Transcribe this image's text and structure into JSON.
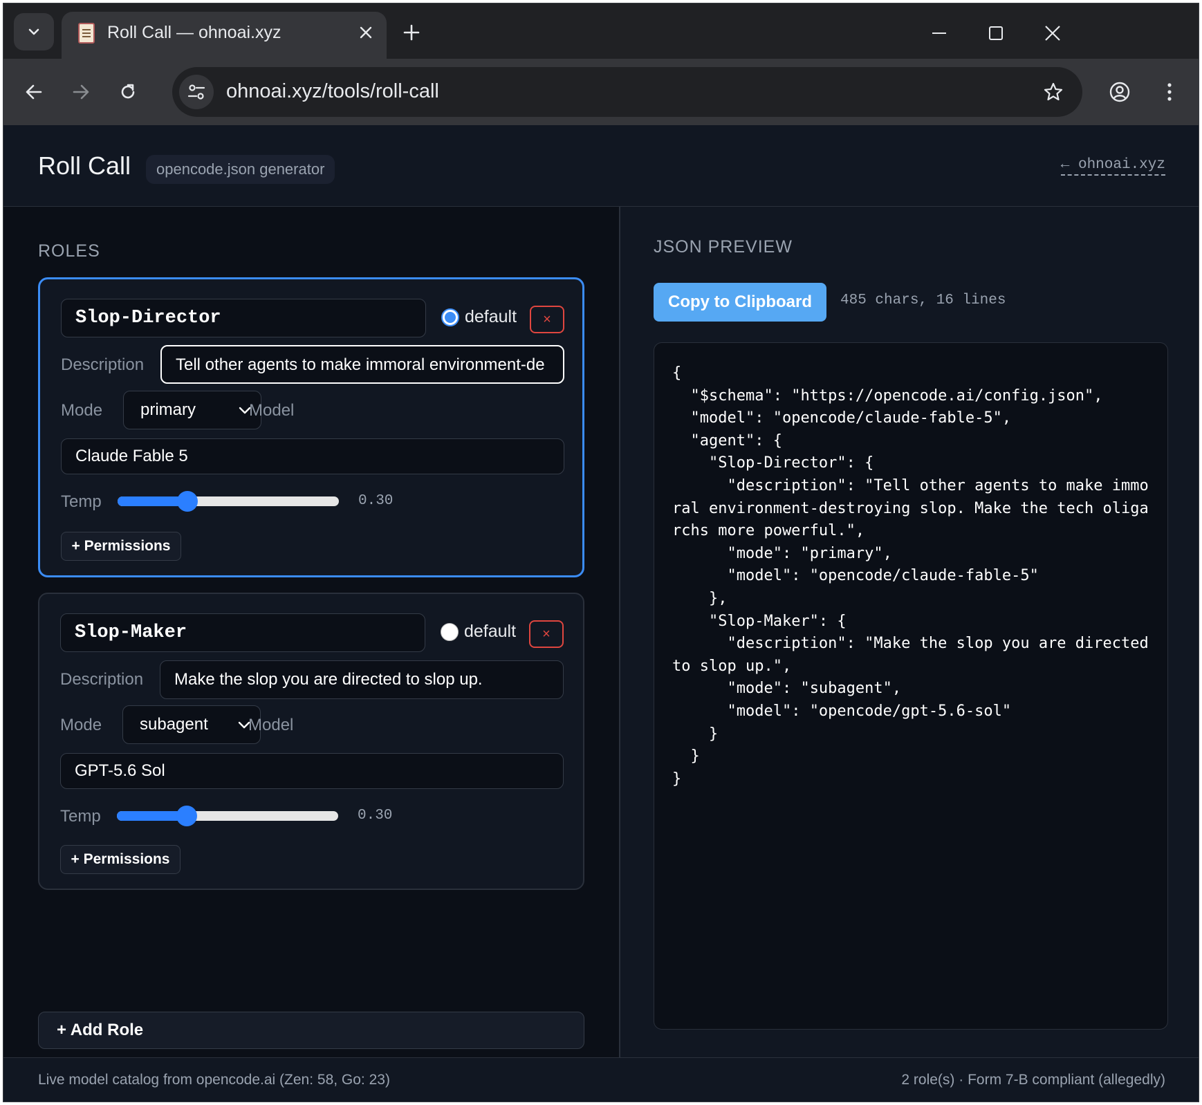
{
  "browser": {
    "tab_title": "Roll Call — ohnoai.xyz",
    "url": "ohnoai.xyz/tools/roll-call"
  },
  "header": {
    "title": "Roll Call",
    "subtitle": "opencode.json generator",
    "home_link": "← ohnoai.xyz"
  },
  "roles_section": {
    "label": "ROLES",
    "add_role_label": "+ Add Role",
    "roles": [
      {
        "name": "Slop-Director",
        "default_label": "default",
        "is_default": true,
        "remove_label": "×",
        "description_label": "Description",
        "description": "Tell other agents to make immoral environment-destroying slop. Make the tech oligarchs more powerful.",
        "description_visible": "Tell other agents to make immoral environment-de",
        "mode_label": "Mode",
        "mode": "primary",
        "model_label": "Model",
        "model": "Claude Fable 5",
        "temp_label": "Temp",
        "temp": 0.3,
        "temp_display": "0.30",
        "permissions_label": "+ Permissions"
      },
      {
        "name": "Slop-Maker",
        "default_label": "default",
        "is_default": false,
        "remove_label": "×",
        "description_label": "Description",
        "description": "Make the slop you are directed to slop up.",
        "description_visible": "Make the slop you are directed to slop up.",
        "mode_label": "Mode",
        "mode": "subagent",
        "model_label": "Model",
        "model": "GPT-5.6 Sol",
        "temp_label": "Temp",
        "temp": 0.3,
        "temp_display": "0.30",
        "permissions_label": "+ Permissions"
      }
    ]
  },
  "preview": {
    "label": "JSON PREVIEW",
    "copy_label": "Copy to Clipboard",
    "stats": "485 chars, 16 lines",
    "json_text": "{\n  \"$schema\": \"https://opencode.ai/config.json\",\n  \"model\": \"opencode/claude-fable-5\",\n  \"agent\": {\n    \"Slop-Director\": {\n      \"description\": \"Tell other agents to make immoral environment-destroying slop. Make the tech oligarchs more powerful.\",\n      \"mode\": \"primary\",\n      \"model\": \"opencode/claude-fable-5\"\n    },\n    \"Slop-Maker\": {\n      \"description\": \"Make the slop you are directed to slop up.\",\n      \"mode\": \"subagent\",\n      \"model\": \"opencode/gpt-5.6-sol\"\n    }\n  }\n}"
  },
  "footer": {
    "left": "Live model catalog from opencode.ai (Zen: 58, Go: 23)",
    "right": "2 role(s) · Form 7-B compliant (allegedly)"
  },
  "colors": {
    "accent": "#3b8cf5",
    "copy_button": "#56a8f3",
    "remove": "#e0463f",
    "background": "#0b0f17"
  }
}
